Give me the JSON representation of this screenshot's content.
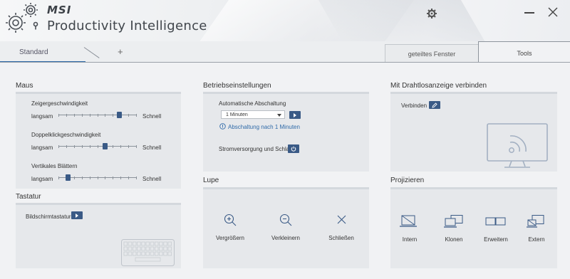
{
  "header": {
    "brand": "MSI",
    "app_title": "Productivity Intelligence"
  },
  "tabs": {
    "standard": "Standard",
    "add": "+",
    "shared_window": "geteiltes Fenster",
    "tools": "Tools"
  },
  "maus": {
    "title": "Maus",
    "sliders": [
      {
        "label": "Zeigergeschwindigkeit",
        "min_label": "langsam",
        "max_label": "Schnell",
        "value": 0.8
      },
      {
        "label": "Doppelklickgeschwindigkeit",
        "min_label": "langsam",
        "max_label": "Schnell",
        "value": 0.6
      },
      {
        "label": "Vertikales Blättern",
        "min_label": "langsam",
        "max_label": "Schnell",
        "value": 0.1
      }
    ]
  },
  "tastatur": {
    "title": "Tastatur",
    "on_screen_keyboard": "Bildschirmtastatur"
  },
  "betrieb": {
    "title": "Betriebseinstellungen",
    "auto_off_label": "Automatische Abschaltung",
    "auto_off_value": "1 Minuten",
    "info": "Abschaltung nach 1 Minuten",
    "power_label": "Stromversorgung und Schlaf"
  },
  "lupe": {
    "title": "Lupe",
    "zoom_in": "Vergrößern",
    "zoom_out": "Verkleinern",
    "close": "Schließen"
  },
  "wireless": {
    "title": "Mit Drahtlosanzeige verbinden",
    "connect": "Verbinden"
  },
  "projizieren": {
    "title": "Projizieren",
    "intern": "Intern",
    "klonen": "Klonen",
    "erweitern": "Erweitern",
    "extern": "Extern"
  },
  "colors": {
    "accent": "#3a5a86",
    "tab_underline": "#2f6aa8",
    "info_blue": "#2f6aa8"
  }
}
